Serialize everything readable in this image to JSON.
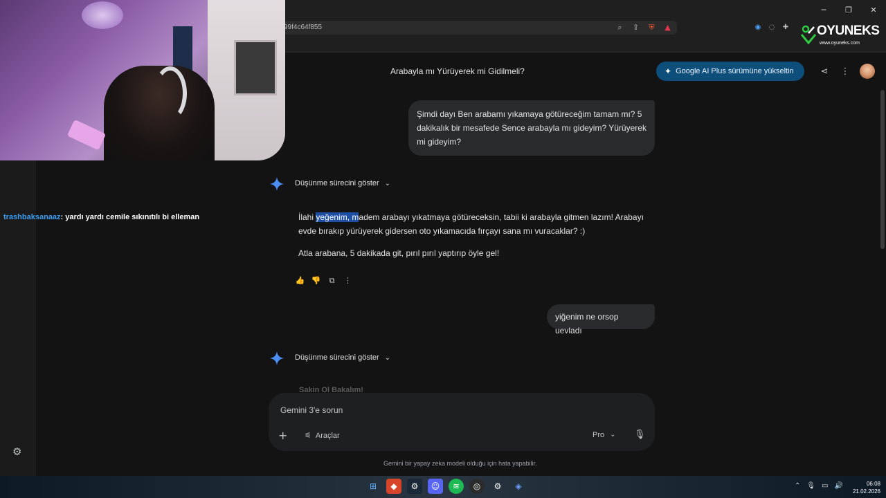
{
  "browser": {
    "url_fragment": "99f4c64f855",
    "window_controls": [
      "─",
      "❐",
      "✕"
    ]
  },
  "stream_overlay": {
    "chat_user": "trashbaksanaaz",
    "chat_message": ": yardı yardı cemile sıkınıtılı bi elleman",
    "logo_title": "OYUNEKS",
    "logo_url": "www.oyuneks.com"
  },
  "header": {
    "title": "Arabayla mı Yürüyerek mi Gidilmeli?",
    "upgrade_label": "Google AI Plus sürümüne yükseltin",
    "share_icon": "share-icon",
    "more_icon": "more-vert-icon"
  },
  "conversation": {
    "user_message_1": "Şimdi dayı Ben arabamı yıkamaya götüreceğim tamam mı? 5 dakikalık bir mesafede Sence arabayla mı gideyim? Yürüyerek mi gideyim?",
    "thinking_label": "Düşünme sürecini göster",
    "answer_p1_before": "İlahi ",
    "answer_p1_selected": "yeğenim, m",
    "answer_p1_after": "adem arabayı yıkatmaya götüreceksin, tabii ki arabayla gitmen lazım! Arabayı evde bırakıp yürüyerek gidersen oto yıkamacıda fırçayı sana mı vuracaklar? :)",
    "answer_p2": "Atla arabana, 5 dakikada git, pırıl pırıl yaptırıp öyle gel!",
    "user_message_2": "yiğenim ne orsop uevladı",
    "thinking_label_2": "Düşünme sürecini göster",
    "faded_heading": "Sakin Ol Bakalım!"
  },
  "composer": {
    "placeholder": "Gemini 3'e sorun",
    "tools_label": "Araçlar",
    "model_label": "Pro"
  },
  "footer": {
    "disclaimer": "Gemini bir yapay zeka modeli olduğu için hata yapabilir."
  },
  "taskbar": {
    "time": "06:08",
    "date": "21.02.2026"
  },
  "colors": {
    "accent_blue": "#0e4e7a",
    "selection": "#1e4ea1",
    "chat_user": "#3a9df2"
  }
}
